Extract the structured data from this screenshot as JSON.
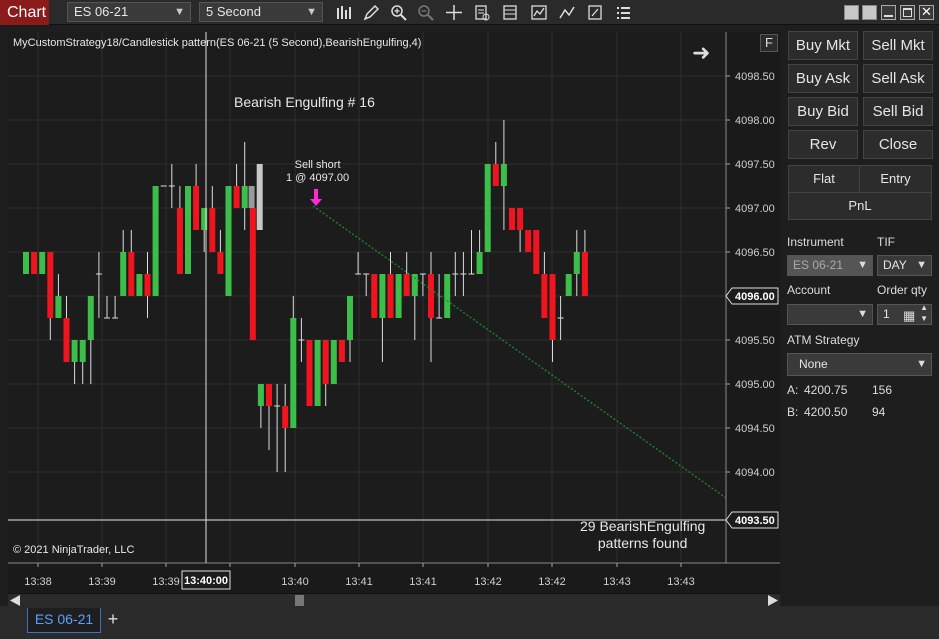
{
  "toolbar": {
    "chart_tab": "Chart",
    "instrument": "ES 06-21",
    "interval": "5 Second",
    "icons": [
      "bars-icon",
      "pencil-icon",
      "zoom-in-icon",
      "zoom-out-icon",
      "crosshair-icon",
      "data-box-icon",
      "indicators-icon",
      "strategies-icon",
      "line-icon",
      "properties-icon",
      "menu-icon"
    ]
  },
  "chart": {
    "title": "MyCustomStrategy18/Candlestick pattern(ES 06-21 (5 Second),BearishEngulfing,4)",
    "pattern_label": "Bearish Engulfing # 16",
    "order_line1": "Sell short",
    "order_line2": "1 @ 4097.00",
    "found_line1": "29 BearishEngulfing",
    "found_line2": "patterns found",
    "copyright": "© 2021 NinjaTrader, LLC",
    "f_button": "F",
    "cursor_time": "13:40:00",
    "last_price": "4096.00",
    "line_price": "4093.50",
    "up_color": "#3cbf4a",
    "down_color": "#f0141e"
  },
  "chart_data": {
    "type": "candlestick",
    "y_ticks": [
      "4098.50",
      "4098.00",
      "4097.50",
      "4097.00",
      "4096.50",
      "4096.00",
      "4095.50",
      "4095.00",
      "4094.50",
      "4094.00"
    ],
    "x_ticks": [
      "13:38",
      "13:39",
      "13:39",
      "13:40",
      "13:40",
      "13:41",
      "13:41",
      "13:42",
      "13:42",
      "13:43",
      "13:43"
    ],
    "ylim": [
      4093.3,
      4098.95
    ],
    "candles": [
      {
        "o": 4096.25,
        "h": 4096.5,
        "l": 4096.25,
        "c": 4096.5
      },
      {
        "o": 4096.5,
        "h": 4096.5,
        "l": 4096.25,
        "c": 4096.25
      },
      {
        "o": 4096.25,
        "h": 4096.5,
        "l": 4096.25,
        "c": 4096.5
      },
      {
        "o": 4096.5,
        "h": 4096.5,
        "l": 4095.5,
        "c": 4095.75
      },
      {
        "o": 4095.75,
        "h": 4096.25,
        "l": 4095.75,
        "c": 4096.0
      },
      {
        "o": 4095.75,
        "h": 4096.0,
        "l": 4095.25,
        "c": 4095.25
      },
      {
        "o": 4095.25,
        "h": 4095.5,
        "l": 4095.0,
        "c": 4095.5
      },
      {
        "o": 4095.25,
        "h": 4095.5,
        "l": 4095.0,
        "c": 4095.5
      },
      {
        "o": 4095.5,
        "h": 4096.0,
        "l": 4095.0,
        "c": 4096.0
      },
      {
        "o": 4096.25,
        "h": 4096.5,
        "l": 4095.75,
        "c": 4096.25
      },
      {
        "o": 4095.75,
        "h": 4096.0,
        "l": 4095.75,
        "c": 4095.75
      },
      {
        "o": 4095.75,
        "h": 4096.0,
        "l": 4095.75,
        "c": 4095.75
      },
      {
        "o": 4096.0,
        "h": 4096.75,
        "l": 4096.0,
        "c": 4096.5
      },
      {
        "o": 4096.5,
        "h": 4096.75,
        "l": 4096.0,
        "c": 4096.0
      },
      {
        "o": 4096.0,
        "h": 4096.25,
        "l": 4096.0,
        "c": 4096.25
      },
      {
        "o": 4096.25,
        "h": 4096.5,
        "l": 4095.75,
        "c": 4096.0
      },
      {
        "o": 4096.0,
        "h": 4097.25,
        "l": 4096.0,
        "c": 4097.25
      },
      {
        "o": 4097.25,
        "h": 4097.25,
        "l": 4097.25,
        "c": 4097.25
      },
      {
        "o": 4097.25,
        "h": 4097.5,
        "l": 4097.0,
        "c": 4097.25
      },
      {
        "o": 4097.0,
        "h": 4097.25,
        "l": 4096.25,
        "c": 4096.25
      },
      {
        "o": 4096.25,
        "h": 4097.25,
        "l": 4096.25,
        "c": 4097.25
      },
      {
        "o": 4097.25,
        "h": 4097.5,
        "l": 4096.75,
        "c": 4096.75
      },
      {
        "o": 4096.75,
        "h": 4097.0,
        "l": 4096.5,
        "c": 4097.0
      },
      {
        "o": 4097.0,
        "h": 4097.25,
        "l": 4096.5,
        "c": 4096.5
      },
      {
        "o": 4096.5,
        "h": 4096.75,
        "l": 4096.25,
        "c": 4096.25
      },
      {
        "o": 4096.0,
        "h": 4097.25,
        "l": 4096.0,
        "c": 4097.25
      },
      {
        "o": 4097.25,
        "h": 4097.5,
        "l": 4097.0,
        "c": 4097.0
      },
      {
        "o": 4097.0,
        "h": 4097.75,
        "l": 4096.75,
        "c": 4097.25
      },
      {
        "o": 4097.0,
        "h": 4097.25,
        "l": 4095.5,
        "c": 4095.5
      },
      {
        "o": 4094.75,
        "h": 4095.0,
        "l": 4094.5,
        "c": 4095.0
      },
      {
        "o": 4095.0,
        "h": 4095.0,
        "l": 4094.25,
        "c": 4094.75
      },
      {
        "o": 4094.75,
        "h": 4095.0,
        "l": 4094.0,
        "c": 4094.75
      },
      {
        "o": 4094.75,
        "h": 4095.0,
        "l": 4094.0,
        "c": 4094.5
      },
      {
        "o": 4094.5,
        "h": 4096.0,
        "l": 4094.5,
        "c": 4095.75
      },
      {
        "o": 4095.5,
        "h": 4095.75,
        "l": 4095.25,
        "c": 4095.5
      },
      {
        "o": 4095.5,
        "h": 4095.5,
        "l": 4094.75,
        "c": 4094.75
      },
      {
        "o": 4094.75,
        "h": 4095.5,
        "l": 4094.75,
        "c": 4095.5
      },
      {
        "o": 4095.5,
        "h": 4095.5,
        "l": 4094.75,
        "c": 4095.0
      },
      {
        "o": 4095.0,
        "h": 4095.5,
        "l": 4095.0,
        "c": 4095.5
      },
      {
        "o": 4095.5,
        "h": 4095.5,
        "l": 4095.25,
        "c": 4095.25
      },
      {
        "o": 4095.5,
        "h": 4096.0,
        "l": 4095.25,
        "c": 4096.0
      },
      {
        "o": 4096.25,
        "h": 4096.5,
        "l": 4096.25,
        "c": 4096.25
      },
      {
        "o": 4096.25,
        "h": 4096.25,
        "l": 4096.0,
        "c": 4096.25
      },
      {
        "o": 4096.25,
        "h": 4096.25,
        "l": 4095.75,
        "c": 4095.75
      },
      {
        "o": 4095.75,
        "h": 4096.25,
        "l": 4095.25,
        "c": 4096.25
      },
      {
        "o": 4096.25,
        "h": 4096.5,
        "l": 4095.75,
        "c": 4095.75
      },
      {
        "o": 4095.75,
        "h": 4096.25,
        "l": 4095.75,
        "c": 4096.25
      },
      {
        "o": 4096.25,
        "h": 4096.5,
        "l": 4096.0,
        "c": 4096.0
      },
      {
        "o": 4096.0,
        "h": 4096.25,
        "l": 4095.5,
        "c": 4096.25
      },
      {
        "o": 4096.25,
        "h": 4096.25,
        "l": 4096.0,
        "c": 4096.25
      },
      {
        "o": 4096.25,
        "h": 4096.5,
        "l": 4095.25,
        "c": 4095.75
      },
      {
        "o": 4095.75,
        "h": 4096.25,
        "l": 4095.75,
        "c": 4095.75
      },
      {
        "o": 4095.75,
        "h": 4096.25,
        "l": 4095.75,
        "c": 4096.25
      },
      {
        "o": 4096.25,
        "h": 4096.5,
        "l": 4096.0,
        "c": 4096.25
      },
      {
        "o": 4096.25,
        "h": 4096.5,
        "l": 4096.0,
        "c": 4096.25
      },
      {
        "o": 4096.25,
        "h": 4096.75,
        "l": 4096.25,
        "c": 4096.25
      },
      {
        "o": 4096.25,
        "h": 4096.75,
        "l": 4096.25,
        "c": 4096.5
      },
      {
        "o": 4096.5,
        "h": 4097.5,
        "l": 4096.5,
        "c": 4097.5
      },
      {
        "o": 4097.5,
        "h": 4097.75,
        "l": 4097.25,
        "c": 4097.25
      },
      {
        "o": 4097.25,
        "h": 4098.0,
        "l": 4096.75,
        "c": 4097.5
      },
      {
        "o": 4097.0,
        "h": 4097.0,
        "l": 4096.75,
        "c": 4096.75
      },
      {
        "o": 4097.0,
        "h": 4097.0,
        "l": 4096.5,
        "c": 4096.75
      },
      {
        "o": 4096.75,
        "h": 4096.75,
        "l": 4096.5,
        "c": 4096.5
      },
      {
        "o": 4096.75,
        "h": 4096.75,
        "l": 4096.25,
        "c": 4096.25
      },
      {
        "o": 4096.25,
        "h": 4096.5,
        "l": 4095.75,
        "c": 4095.75
      },
      {
        "o": 4096.25,
        "h": 4096.25,
        "l": 4095.25,
        "c": 4095.5
      },
      {
        "o": 4095.75,
        "h": 4096.0,
        "l": 4095.5,
        "c": 4095.75
      },
      {
        "o": 4096.0,
        "h": 4096.25,
        "l": 4096.0,
        "c": 4096.25
      },
      {
        "o": 4096.25,
        "h": 4096.75,
        "l": 4096.0,
        "c": 4096.5
      },
      {
        "o": 4096.5,
        "h": 4096.75,
        "l": 4096.0,
        "c": 4096.0
      }
    ]
  },
  "panel": {
    "buy_mkt": "Buy Mkt",
    "sell_mkt": "Sell Mkt",
    "buy_ask": "Buy Ask",
    "sell_ask": "Sell Ask",
    "buy_bid": "Buy Bid",
    "sell_bid": "Sell Bid",
    "rev": "Rev",
    "close": "Close",
    "flat": "Flat",
    "entry": "Entry",
    "pnl": "PnL",
    "instrument_label": "Instrument",
    "instrument_value": "ES 06-21",
    "tif_label": "TIF",
    "tif_value": "DAY",
    "account_label": "Account",
    "account_value": "",
    "qty_label": "Order qty",
    "qty_value": "1",
    "atm_label": "ATM Strategy",
    "atm_value": "None",
    "ask_label": "A:",
    "ask_price": "4200.75",
    "ask_size": "156",
    "bid_label": "B:",
    "bid_price": "4200.50",
    "bid_size": "94"
  },
  "bottom": {
    "instrument_tab": "ES 06-21",
    "add_tab": "+"
  }
}
